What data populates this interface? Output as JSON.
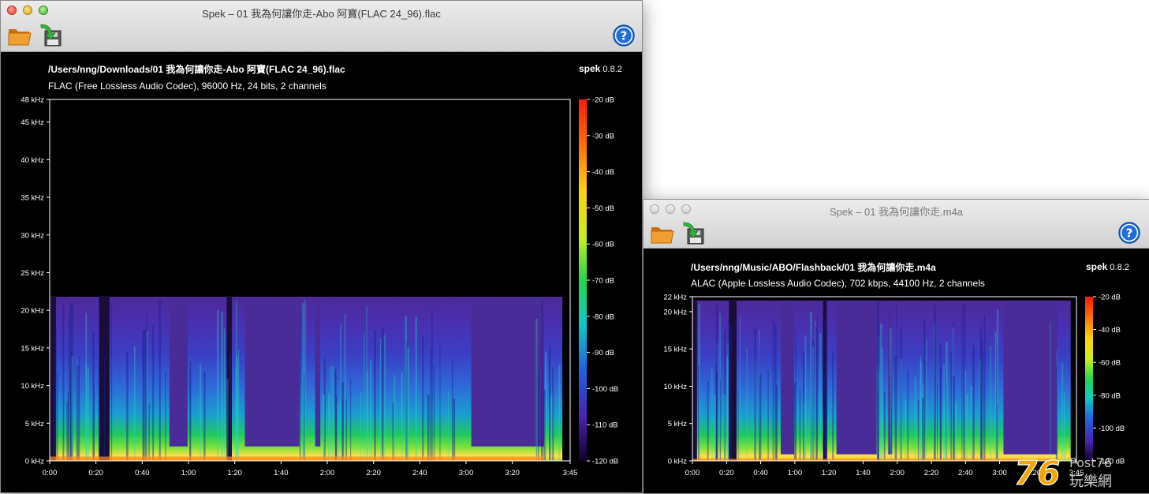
{
  "windows": [
    {
      "title": "Spek – 01 我為何讓你走-Abo 阿寶(FLAC 24_96).flac",
      "file_path": "/Users/nng/Downloads/01 我為何讓你走-Abo 阿寶(FLAC 24_96).flac",
      "codec_info": "FLAC (Free Lossless Audio Codec), 96000 Hz, 24 bits, 2 channels",
      "brand_name": "spek",
      "brand_version": "0.8.2",
      "active": true,
      "freq_max_khz": 48,
      "freq_ticks": [
        {
          "label": "0 kHz",
          "value": 0
        },
        {
          "label": "5 kHz",
          "value": 5
        },
        {
          "label": "10 kHz",
          "value": 10
        },
        {
          "label": "15 kHz",
          "value": 15
        },
        {
          "label": "20 kHz",
          "value": 20
        },
        {
          "label": "25 kHz",
          "value": 25
        },
        {
          "label": "30 kHz",
          "value": 30
        },
        {
          "label": "35 kHz",
          "value": 35
        },
        {
          "label": "40 kHz",
          "value": 40
        },
        {
          "label": "45 kHz",
          "value": 45
        },
        {
          "label": "48 kHz",
          "value": 48
        }
      ],
      "time_ticks": [
        "0:00",
        "0:20",
        "0:40",
        "1:00",
        "1:20",
        "1:40",
        "2:00",
        "2:20",
        "2:40",
        "3:00",
        "3:20",
        "3:45"
      ],
      "duration_s": 225,
      "content_cutoff_khz": 21.8,
      "db_ticks": [
        "-20 dB",
        "-30 dB",
        "-40 dB",
        "-50 dB",
        "-60 dB",
        "-70 dB",
        "-80 dB",
        "-90 dB",
        "-100 dB",
        "-110 dB",
        "-120 dB"
      ]
    },
    {
      "title": "Spek – 01 我為何讓你走.m4a",
      "file_path": "/Users/nng/Music/ABO/Flashback/01 我為何讓你走.m4a",
      "codec_info": "ALAC (Apple Lossless Audio Codec), 702 kbps, 44100 Hz, 2 channels",
      "brand_name": "spek",
      "brand_version": "0.8.2",
      "active": false,
      "freq_max_khz": 22,
      "freq_ticks": [
        {
          "label": "0 kHz",
          "value": 0
        },
        {
          "label": "5 kHz",
          "value": 5
        },
        {
          "label": "10 kHz",
          "value": 10
        },
        {
          "label": "15 kHz",
          "value": 15
        },
        {
          "label": "20 kHz",
          "value": 20
        },
        {
          "label": "22 kHz",
          "value": 22
        }
      ],
      "time_ticks": [
        "0:00",
        "0:20",
        "0:40",
        "1:00",
        "1:20",
        "1:40",
        "2:00",
        "2:20",
        "2:40",
        "3:00",
        "3:20",
        "3:45"
      ],
      "duration_s": 225,
      "content_cutoff_khz": 21.5,
      "db_ticks": [
        "-20 dB",
        "-40 dB",
        "-60 dB",
        "-80 dB",
        "-100 dB",
        "-120 dB"
      ]
    }
  ],
  "colors": {
    "titlebar": "#d8d8d8",
    "plot_bg": "#000000",
    "axis": "#ffffff",
    "help_blue": "#1f6fd6",
    "folder": "#e08a1e",
    "arrow_green": "#2fae3a"
  },
  "watermark": {
    "big": "76",
    "latin": "Post76",
    "cjk": "玩樂網"
  }
}
